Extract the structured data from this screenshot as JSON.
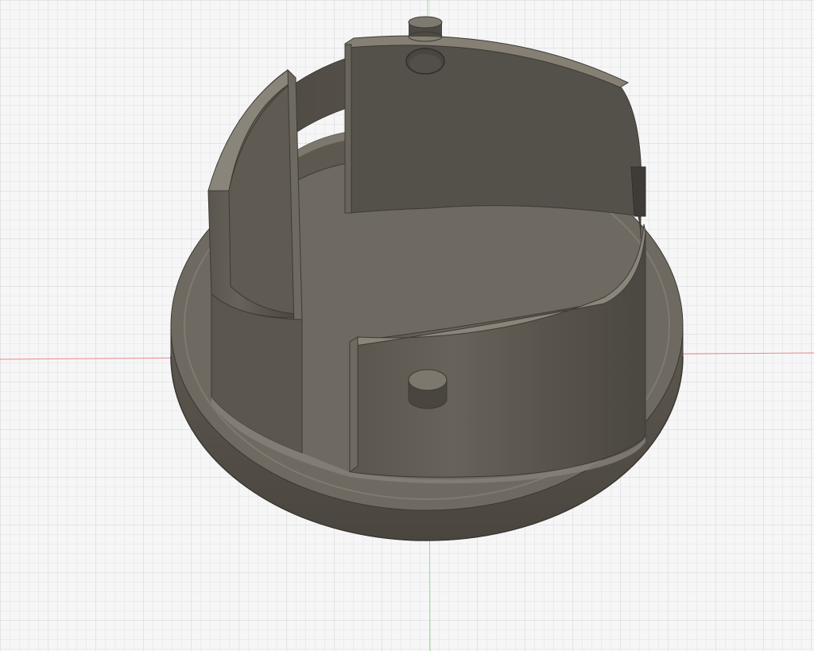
{
  "viewport": {
    "background": "#f6f6f7",
    "grid_minor_color": "#e2e3e6",
    "grid_major_color": "#cfd1d5",
    "x_axis_color": "#e88a8a",
    "y_axis_color": "#9fd99f"
  },
  "model": {
    "part": "split-ring-collar-with-flange",
    "body_color": "#57524a",
    "top_face_color": "#7c776d",
    "shadow_color": "#3d3a35",
    "pin_count": 2
  }
}
